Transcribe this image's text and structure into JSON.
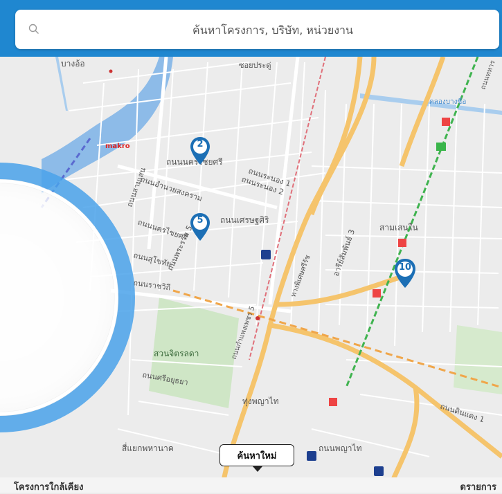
{
  "search": {
    "placeholder": "ค้นหาโครงการ, บริษัท, หน่วยงาน"
  },
  "map": {
    "labels": [
      "บางอ้อ",
      "ซอยประดู่",
      "ถนนนครไชยศรี",
      "ถนนระนอง 1",
      "ถนนระนอง 2",
      "ถนนอำนวยสงคราม",
      "ถนนเศรษฐศิริ",
      "ถนนนครไชยศรี",
      "ถนนพระราม 5",
      "ถนนสุโขทัย",
      "ถนนราชวิถี",
      "สวนจิตรลดา",
      "ถนนศรีอยุธยา",
      "ทุ่งพญาไท",
      "ถนนพญาไท",
      "สี่แยกพหานาค",
      "สามเสนใน",
      "อารีย์สัมพันธ์ 3",
      "คลองบางซื่อ",
      "ถนนดินแดง 1",
      "ถนนสามเสน",
      "ทางพิเศษศรีรัช",
      "ถนนกำแพงเพชร 5",
      "makro",
      "ถนนทหาร",
      "ถนนศรีอยุธยา"
    ],
    "pins": [
      "2",
      "5",
      "10"
    ],
    "accent_color": "#1c6fb5",
    "header_color": "#1f87d0"
  },
  "search_again_label": "ค้นหาใหม่",
  "bottom": {
    "left_label": "โครงการใกล้เคียง",
    "right_label": "ดรายการ"
  }
}
